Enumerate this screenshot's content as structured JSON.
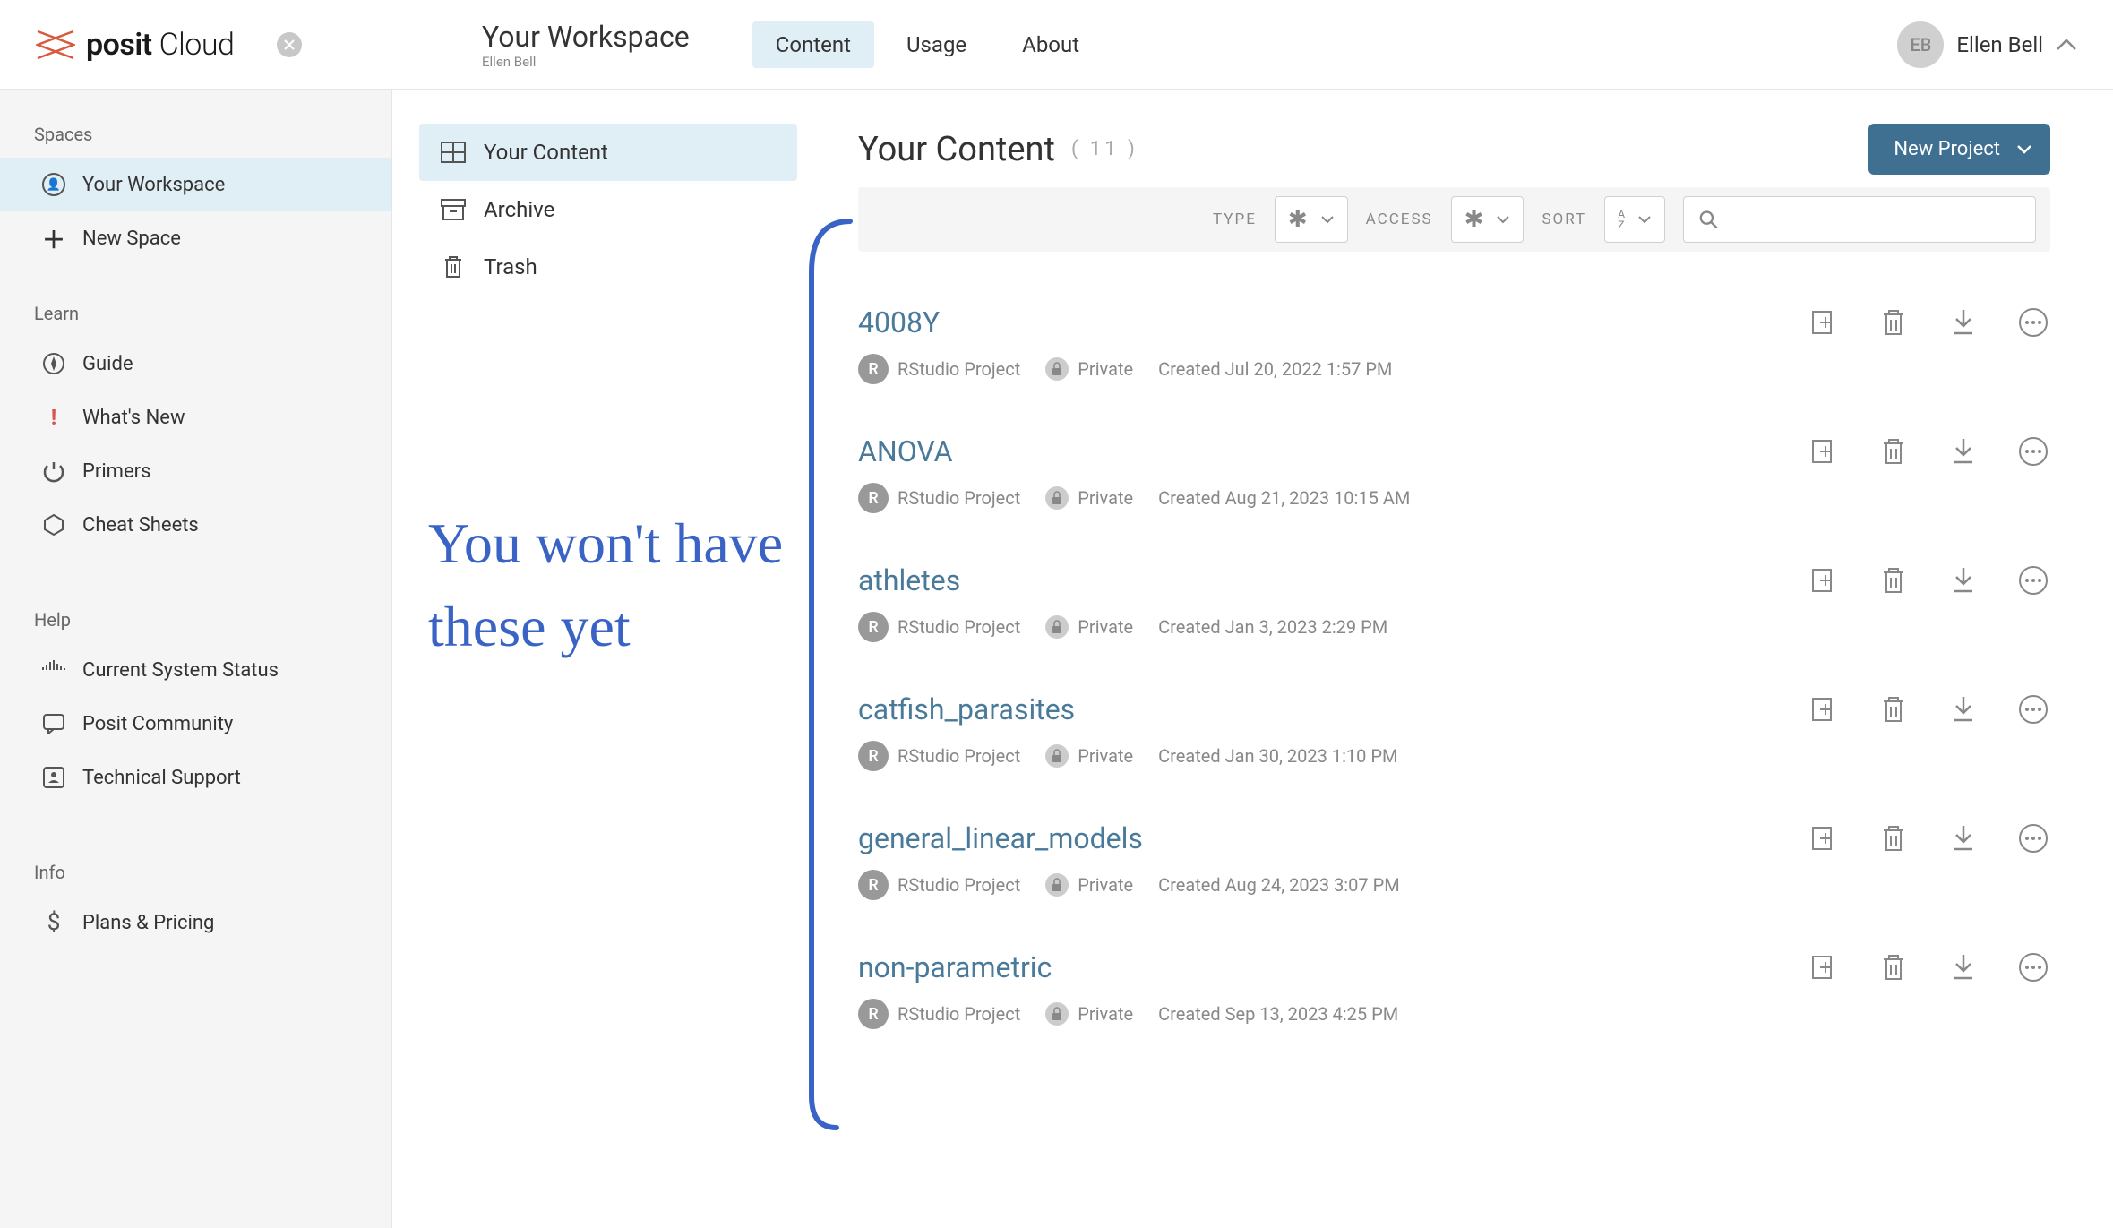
{
  "brand": {
    "name_strong": "posit",
    "name_light": "Cloud"
  },
  "header": {
    "workspace_title": "Your Workspace",
    "workspace_owner": "Ellen Bell",
    "tabs": {
      "content": "Content",
      "usage": "Usage",
      "about": "About"
    },
    "user_initials": "EB",
    "user_name": "Ellen Bell"
  },
  "sidebar": {
    "spaces_label": "Spaces",
    "your_workspace": "Your Workspace",
    "new_space": "New Space",
    "learn_label": "Learn",
    "guide": "Guide",
    "whats_new": "What's New",
    "primers": "Primers",
    "cheat_sheets": "Cheat Sheets",
    "help_label": "Help",
    "system_status": "Current System Status",
    "community": "Posit Community",
    "tech_support": "Technical Support",
    "info_label": "Info",
    "plans_pricing": "Plans & Pricing"
  },
  "midnav": {
    "your_content": "Your Content",
    "archive": "Archive",
    "trash": "Trash"
  },
  "annotation": "You won't have these yet",
  "content": {
    "title": "Your Content",
    "count": "( 11 )",
    "new_project_label": "New Project",
    "filters": {
      "type": "TYPE",
      "access": "ACCESS",
      "sort": "SORT"
    }
  },
  "projects": [
    {
      "name": "4008Y",
      "type": "RStudio Project",
      "access": "Private",
      "created": "Created Jul 20, 2022 1:57 PM"
    },
    {
      "name": "ANOVA",
      "type": "RStudio Project",
      "access": "Private",
      "created": "Created Aug 21, 2023 10:15 AM"
    },
    {
      "name": "athletes",
      "type": "RStudio Project",
      "access": "Private",
      "created": "Created Jan 3, 2023 2:29 PM"
    },
    {
      "name": "catfish_parasites",
      "type": "RStudio Project",
      "access": "Private",
      "created": "Created Jan 30, 2023 1:10 PM"
    },
    {
      "name": "general_linear_models",
      "type": "RStudio Project",
      "access": "Private",
      "created": "Created Aug 24, 2023 3:07 PM"
    },
    {
      "name": "non-parametric",
      "type": "RStudio Project",
      "access": "Private",
      "created": "Created Sep 13, 2023 4:25 PM"
    }
  ]
}
